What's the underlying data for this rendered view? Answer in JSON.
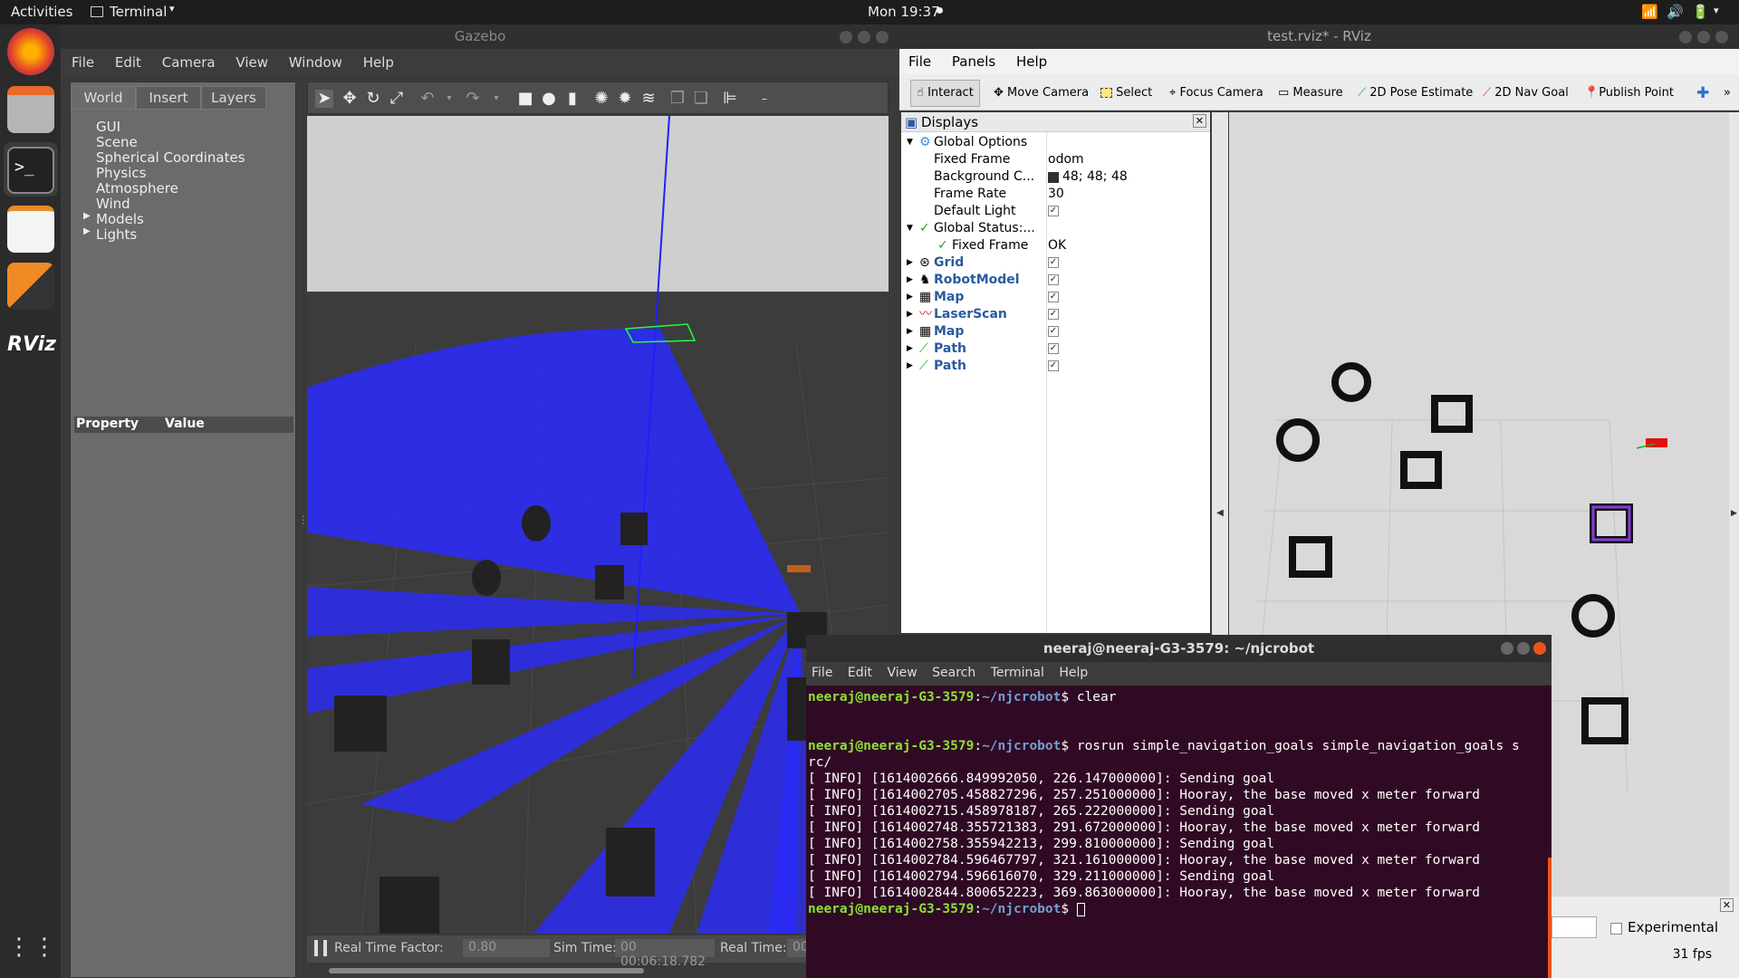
{
  "topbar": {
    "activities": "Activities",
    "app_menu": "Terminal",
    "clock": "Mon 19:37"
  },
  "gazebo": {
    "title": "Gazebo",
    "menu": [
      "File",
      "Edit",
      "Camera",
      "View",
      "Window",
      "Help"
    ],
    "tabs": [
      "World",
      "Insert",
      "Layers"
    ],
    "tree": [
      "GUI",
      "Scene",
      "Spherical Coordinates",
      "Physics",
      "Atmosphere",
      "Wind",
      "Models",
      "Lights"
    ],
    "prop_header": {
      "property": "Property",
      "value": "Value"
    },
    "status": {
      "rtf_label": "Real Time Factor:",
      "rtf_value": "0.80",
      "sim_label": "Sim Time:",
      "sim_value": "00 00:06:18.782",
      "real_label": "Real Time:",
      "real_value": "00"
    }
  },
  "rviz": {
    "title": "test.rviz* - RViz",
    "menu": [
      "File",
      "Panels",
      "Help"
    ],
    "tools": [
      "Interact",
      "Move Camera",
      "Select",
      "Focus Camera",
      "Measure",
      "2D Pose Estimate",
      "2D Nav Goal",
      "Publish Point"
    ],
    "displays_title": "Displays",
    "rows": [
      {
        "name": "Global Options",
        "value": ""
      },
      {
        "name": "Fixed Frame",
        "value": "odom"
      },
      {
        "name": "Background C...",
        "value": "48; 48; 48"
      },
      {
        "name": "Frame Rate",
        "value": "30"
      },
      {
        "name": "Default Light",
        "value": ""
      },
      {
        "name": "Global Status:...",
        "value": ""
      },
      {
        "name": "Fixed Frame",
        "value": "OK"
      },
      {
        "name": "Grid",
        "value": ""
      },
      {
        "name": "RobotModel",
        "value": ""
      },
      {
        "name": "Map",
        "value": ""
      },
      {
        "name": "LaserScan",
        "value": ""
      },
      {
        "name": "Map",
        "value": ""
      },
      {
        "name": "Path",
        "value": ""
      },
      {
        "name": "Path",
        "value": ""
      }
    ],
    "experimental": "Experimental",
    "fps": "31 fps"
  },
  "terminal": {
    "title": "neeraj@neeraj-G3-3579: ~/njcrobot",
    "menu": [
      "File",
      "Edit",
      "View",
      "Search",
      "Terminal",
      "Help"
    ],
    "prompt_user": "neeraj@neeraj-G3-3579",
    "prompt_path": "~/njcrobot",
    "cmd1": " clear",
    "cmd2": " rosrun simple_navigation_goals simple_navigation_goals s",
    "cmd2_wrap": "rc/",
    "log": [
      "[ INFO] [1614002666.849992050, 226.147000000]: Sending goal",
      "[ INFO] [1614002705.458827296, 257.251000000]: Hooray, the base moved x meter forward",
      "[ INFO] [1614002715.458978187, 265.222000000]: Sending goal",
      "[ INFO] [1614002748.355721383, 291.672000000]: Hooray, the base moved x meter forward",
      "[ INFO] [1614002758.355942213, 299.810000000]: Sending goal",
      "[ INFO] [1614002784.596467797, 321.161000000]: Hooray, the base moved x meter forward",
      "[ INFO] [1614002794.596616070, 329.211000000]: Sending goal",
      "[ INFO] [1614002844.800652223, 369.863000000]: Hooray, the base moved x meter forward"
    ]
  }
}
